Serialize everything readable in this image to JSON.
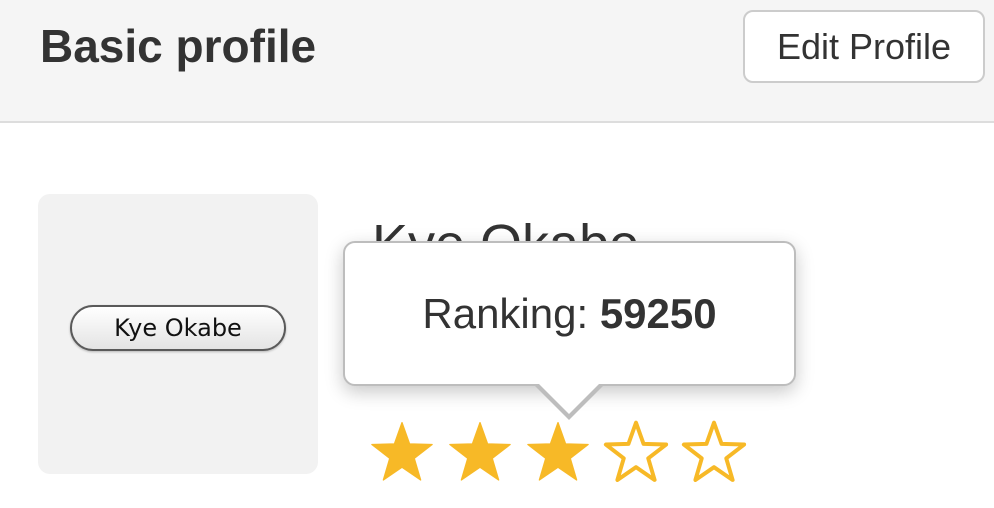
{
  "header": {
    "title": "Basic profile",
    "edit_button_label": "Edit Profile"
  },
  "profile": {
    "name": "Kye Okabe",
    "avatar_label": "Kye Okabe"
  },
  "tooltip": {
    "label": "Ranking: ",
    "value": "59250"
  },
  "rating": {
    "stars_filled": 3,
    "stars_total": 5,
    "star_color": "#f7b927"
  },
  "colors": {
    "header_bg": "#f5f5f5",
    "text": "#333333"
  }
}
